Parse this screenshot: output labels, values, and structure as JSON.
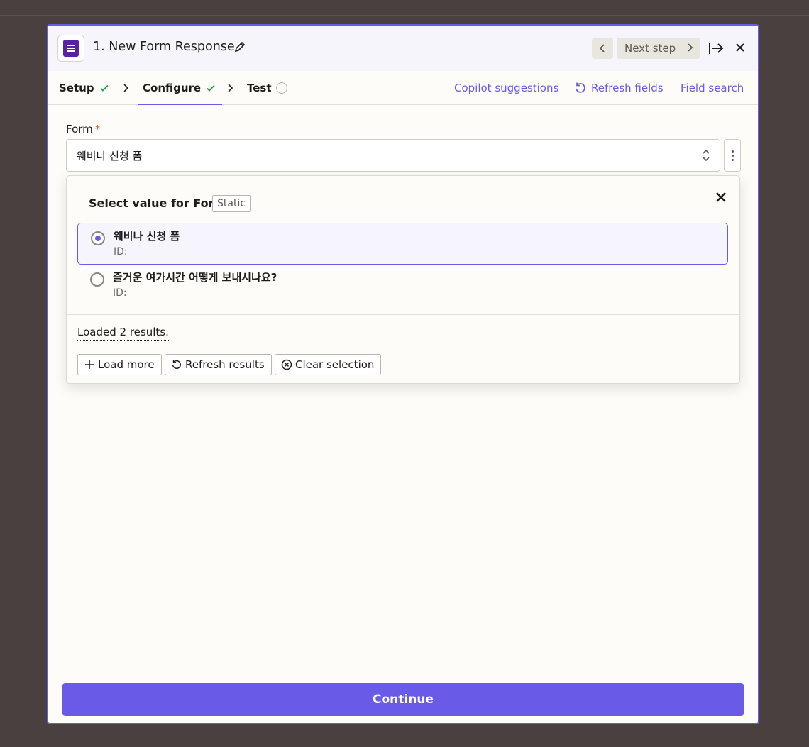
{
  "header": {
    "title": "1. New Form Response",
    "next_step_label": "Next step"
  },
  "tabs": [
    {
      "label": "Setup",
      "status": "complete"
    },
    {
      "label": "Configure",
      "status": "complete"
    },
    {
      "label": "Test",
      "status": "pending"
    }
  ],
  "links": {
    "copilot": "Copilot suggestions",
    "refresh_fields": "Refresh fields",
    "field_search": "Field search"
  },
  "form_field": {
    "label": "Form",
    "required_mark": "*",
    "value": "웨비나 신청 폼"
  },
  "dropdown": {
    "title": "Select value for Form",
    "badge": "Static",
    "options": [
      {
        "name": "웨비나 신청 폼",
        "id": "ID:",
        "selected": true
      },
      {
        "name": "즐거운 여가시간 어떻게 보내시나요?",
        "id": "ID:",
        "selected": false
      }
    ],
    "loaded_text": "Loaded 2 results.",
    "buttons": {
      "load_more": "Load more",
      "refresh_results": "Refresh results",
      "clear_selection": "Clear selection"
    }
  },
  "footer": {
    "continue_label": "Continue"
  },
  "colors": {
    "accent": "#695be8",
    "backdrop": "#4a403f",
    "success": "#1e9e4a",
    "required": "#e3552a"
  }
}
